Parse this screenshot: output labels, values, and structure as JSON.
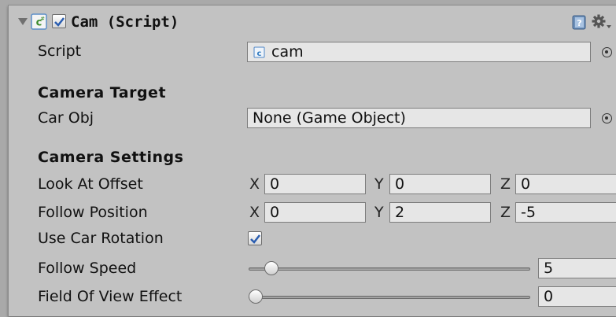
{
  "header": {
    "title": "Cam (Script)",
    "enabled": true,
    "foldout_icon": "triangle-down-icon",
    "script_icon": "csharp-script-icon",
    "help_icon": "help-book-icon",
    "settings_icon": "gear-icon"
  },
  "fields": {
    "script": {
      "label": "Script",
      "value": "cam",
      "icon": "script-file-icon"
    },
    "camera_target_header": "Camera Target",
    "car_obj": {
      "label": "Car Obj",
      "value": "None (Game Object)"
    },
    "camera_settings_header": "Camera Settings",
    "look_at_offset": {
      "label": "Look At Offset",
      "x_label": "X",
      "x": "0",
      "y_label": "Y",
      "y": "0",
      "z_label": "Z",
      "z": "0"
    },
    "follow_position": {
      "label": "Follow Position",
      "x_label": "X",
      "x": "0",
      "y_label": "Y",
      "y": "2",
      "z_label": "Z",
      "z": "-5"
    },
    "use_car_rotation": {
      "label": "Use Car Rotation",
      "checked": true
    },
    "follow_speed": {
      "label": "Follow Speed",
      "value": "5",
      "fraction": 0.06
    },
    "field_of_view_effect": {
      "label": "Field Of View Effect",
      "value": "0",
      "fraction": 0.0
    }
  },
  "colors": {
    "check": "#2a5db0",
    "panel": "#c2c2c2"
  }
}
